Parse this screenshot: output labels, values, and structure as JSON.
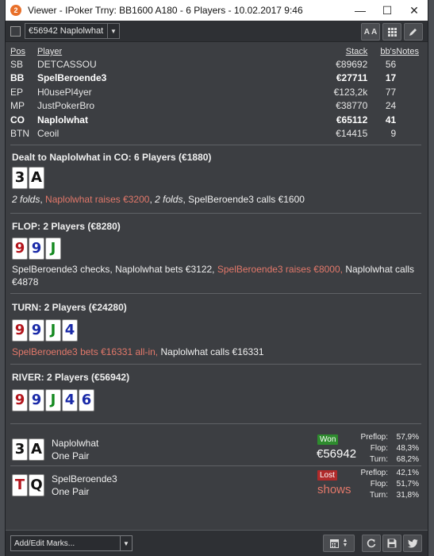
{
  "window": {
    "title": "Viewer - IPoker Trny: BB1600 A180 - 6 Players - 10.02.2017 9:46",
    "app_icon_letter": "2"
  },
  "toolbar": {
    "hand_selector_value": "€56942 Naplolwhat",
    "font_button_label": "A A",
    "grid_button_icon": "grid-icon",
    "edit_button_icon": "pencil-icon"
  },
  "players_table": {
    "headers": {
      "pos": "Pos",
      "player": "Player",
      "stack": "Stack",
      "bbs": "bb's",
      "notes": "Notes"
    },
    "rows": [
      {
        "pos": "SB",
        "player": "DETCASSOU",
        "stack": "€89692",
        "bbs": "56",
        "bold": false
      },
      {
        "pos": "BB",
        "player": "SpelBeroende3",
        "stack": "€27711",
        "bbs": "17",
        "bold": true
      },
      {
        "pos": "EP",
        "player": "H0usePl4yer",
        "stack": "€123,2k",
        "bbs": "77",
        "bold": false
      },
      {
        "pos": "MP",
        "player": "JustPokerBro",
        "stack": "€38770",
        "bbs": "24",
        "bold": false
      },
      {
        "pos": "CO",
        "player": "Naplolwhat",
        "stack": "€65112",
        "bbs": "41",
        "bold": true
      },
      {
        "pos": "BTN",
        "player": "Ceoil",
        "stack": "€14415",
        "bbs": "9",
        "bold": false
      }
    ]
  },
  "preflop": {
    "title": "Dealt to Naplolwhat in CO: 6 Players (€1880)",
    "cards": [
      {
        "rank": "3",
        "color": "#111111"
      },
      {
        "rank": "A",
        "color": "#111111"
      }
    ],
    "action_1": "2 folds",
    "action_2": "Naplolwhat raises €3200",
    "action_3": "2 folds",
    "action_4": "SpelBeroende3 calls €1600"
  },
  "flop": {
    "title": "FLOP: 2 Players (€8280)",
    "cards": [
      {
        "rank": "9",
        "color": "#b3151c"
      },
      {
        "rank": "9",
        "color": "#1a2aa8"
      },
      {
        "rank": "J",
        "color": "#13891f"
      }
    ],
    "action_1": "SpelBeroende3 checks, Naplolwhat bets €3122,",
    "action_2": "SpelBeroende3 raises €8000,",
    "action_3": "Naplolwhat calls €4878"
  },
  "turn": {
    "title": "TURN: 2 Players (€24280)",
    "cards": [
      {
        "rank": "9",
        "color": "#b3151c"
      },
      {
        "rank": "9",
        "color": "#1a2aa8"
      },
      {
        "rank": "J",
        "color": "#13891f"
      },
      {
        "rank": "4",
        "color": "#1a2aa8"
      }
    ],
    "action_1": "SpelBeroende3 bets €16331 all-in,",
    "action_2": "Naplolwhat calls €16331"
  },
  "river": {
    "title": "RIVER: 2 Players (€56942)",
    "cards": [
      {
        "rank": "9",
        "color": "#b3151c"
      },
      {
        "rank": "9",
        "color": "#1a2aa8"
      },
      {
        "rank": "J",
        "color": "#13891f"
      },
      {
        "rank": "4",
        "color": "#1a2aa8"
      },
      {
        "rank": "6",
        "color": "#1a2aa8"
      }
    ]
  },
  "results": [
    {
      "cards": [
        {
          "rank": "3",
          "color": "#111111"
        },
        {
          "rank": "A",
          "color": "#111111"
        }
      ],
      "player": "Naplolwhat",
      "hand": "One Pair",
      "badge": "Won",
      "badge_color": "#2e8b2e",
      "amount": "€56942",
      "amount_color": "#ffffff",
      "preflop_label": "Preflop:",
      "preflop": "57,9%",
      "flop_label": "Flop:",
      "flop": "48,3%",
      "turn_label": "Turn:",
      "turn": "68,2%"
    },
    {
      "cards": [
        {
          "rank": "T",
          "color": "#b3151c"
        },
        {
          "rank": "Q",
          "color": "#111111"
        }
      ],
      "player": "SpelBeroende3",
      "hand": "One Pair",
      "badge": "Lost",
      "badge_color": "#b02a2a",
      "amount": "shows",
      "amount_color": "#e2786a",
      "preflop_label": "Preflop:",
      "preflop": "42,1%",
      "flop_label": "Flop:",
      "flop": "51,7%",
      "turn_label": "Turn:",
      "turn": "31,8%"
    }
  ],
  "bottom": {
    "marks_selector": "Add/Edit Marks...",
    "icons": [
      "calendar-icon",
      "refresh-icon",
      "save-icon",
      "twitter-icon"
    ]
  }
}
